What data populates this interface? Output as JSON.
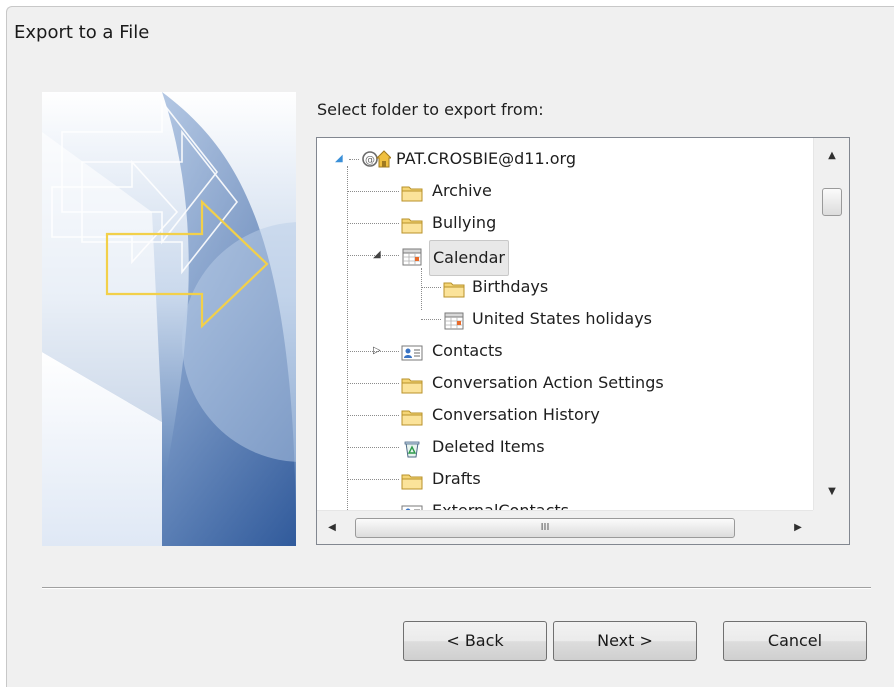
{
  "window": {
    "title": "Export to a File"
  },
  "folder_tree": {
    "label": "Select folder to export from:",
    "items": [
      {
        "label": "PAT.CROSBIE@d11.org",
        "icon": "mailbox-icon",
        "level": 0,
        "expander": "expanded"
      },
      {
        "label": "Archive",
        "icon": "folder-icon",
        "level": 1
      },
      {
        "label": "Bullying",
        "icon": "folder-icon",
        "level": 1
      },
      {
        "label": "Calendar",
        "icon": "calendar-icon",
        "level": 1,
        "expander": "expanded",
        "selected": true
      },
      {
        "label": "Birthdays",
        "icon": "folder-icon",
        "level": 2
      },
      {
        "label": "United States holidays",
        "icon": "calendar-icon",
        "level": 2
      },
      {
        "label": "Contacts",
        "icon": "contacts-icon",
        "level": 1,
        "expander": "collapsed"
      },
      {
        "label": "Conversation Action Settings",
        "icon": "folder-icon",
        "level": 1
      },
      {
        "label": "Conversation History",
        "icon": "folder-icon",
        "level": 1
      },
      {
        "label": "Deleted Items",
        "icon": "recycle-bin-icon",
        "level": 1
      },
      {
        "label": "Drafts",
        "icon": "folder-icon",
        "level": 1
      },
      {
        "label": "ExternalContacts",
        "icon": "contacts-icon",
        "level": 1
      }
    ]
  },
  "scrollbars": {
    "horizontal_thumb_grip": "III"
  },
  "buttons": {
    "back": "< Back",
    "next": "Next >",
    "cancel": "Cancel"
  },
  "colors": {
    "art_blue": "#5c82b9",
    "arrow_yellow": "#f2d04a",
    "folder_yellow": "#f5d576",
    "selection_bg": "#e8e8e8"
  }
}
